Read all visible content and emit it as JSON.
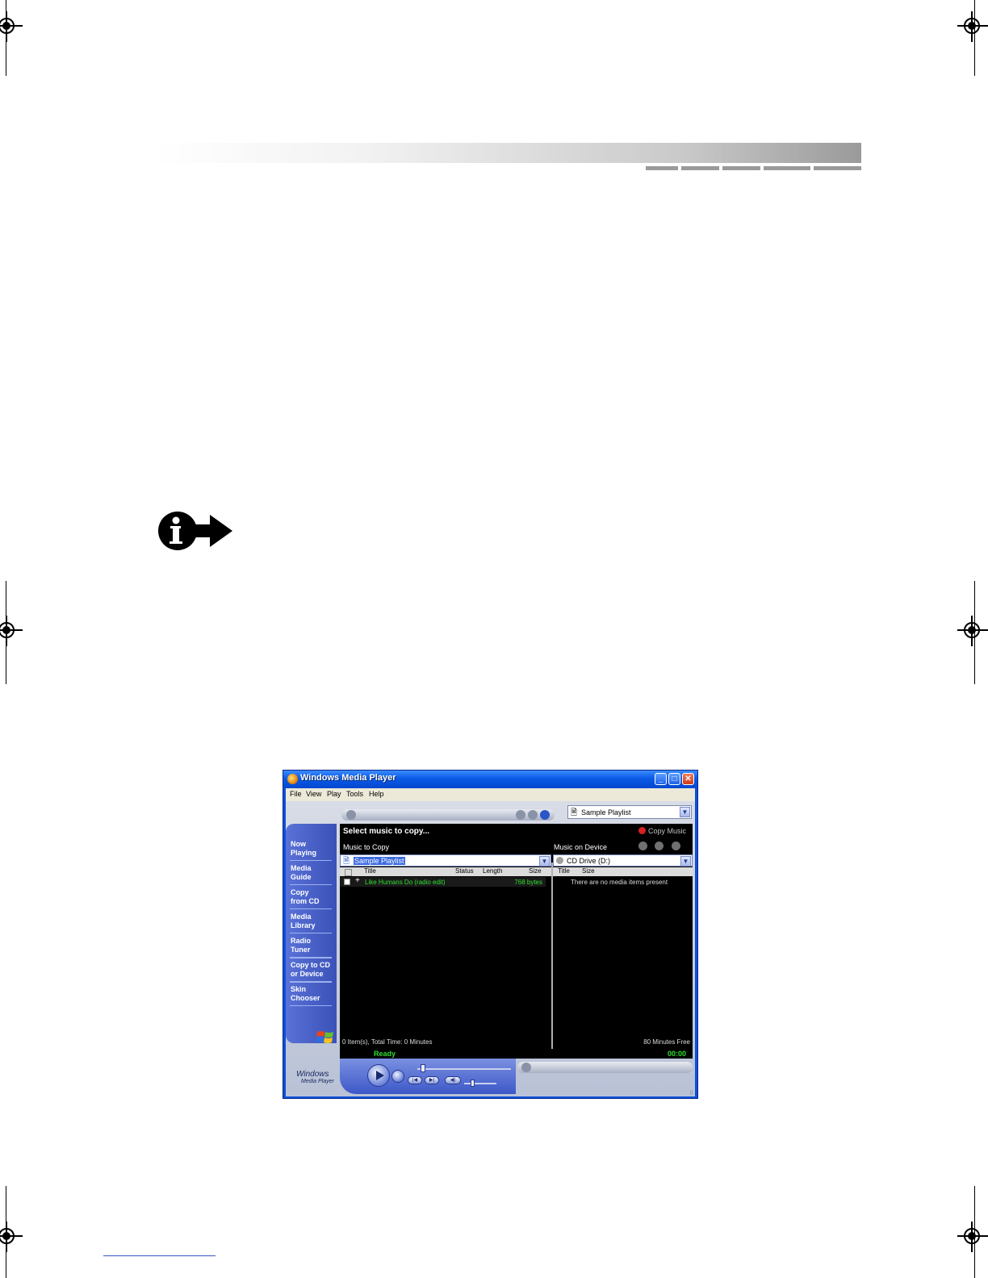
{
  "window": {
    "title": "Windows Media Player"
  },
  "menu": [
    "File",
    "View",
    "Play",
    "Tools",
    "Help"
  ],
  "taskbar": {
    "items": [
      {
        "line1": "Now",
        "line2": "Playing"
      },
      {
        "line1": "Media",
        "line2": "Guide"
      },
      {
        "line1": "Copy",
        "line2": "from CD"
      },
      {
        "line1": "Media",
        "line2": "Library"
      },
      {
        "line1": "Radio",
        "line2": "Tuner"
      },
      {
        "line1": "Copy to CD",
        "line2": "or Device"
      },
      {
        "line1": "Skin",
        "line2": "Chooser"
      }
    ],
    "active_index": 5,
    "logo_line1": "Windows",
    "logo_line2": "Media Player"
  },
  "top": {
    "playlist_select": "Sample Playlist"
  },
  "copy_header": {
    "title": "Select music to copy...",
    "copy_button": "Copy Music"
  },
  "left_pane": {
    "heading": "Music to Copy",
    "select_value": "Sample Playlist",
    "columns": [
      "Title",
      "Status",
      "Length",
      "Size"
    ],
    "tracks": [
      {
        "title": "Like Humans Do (radio edit)",
        "size": "768 bytes"
      }
    ],
    "footer": "0 Item(s), Total Time: 0 Minutes"
  },
  "right_pane": {
    "heading": "Music on Device",
    "select_value": "CD Drive (D:)",
    "columns": [
      "Title",
      "Size"
    ],
    "empty_text": "There are no media items present",
    "footer": "80 Minutes Free"
  },
  "status": {
    "text": "Ready",
    "time": "00:00"
  },
  "colors": {
    "window_blue": "#0d4fd8",
    "status_green": "#2ee02e"
  }
}
